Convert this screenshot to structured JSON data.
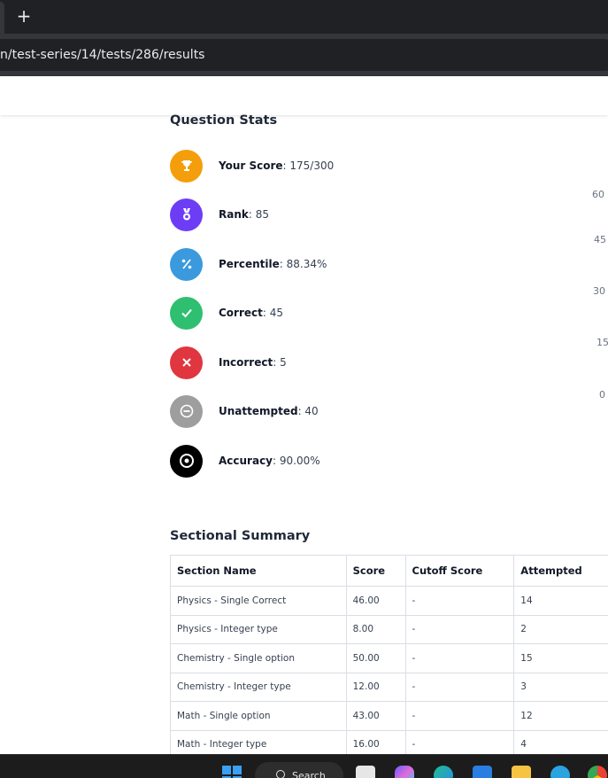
{
  "browser": {
    "new_tab_symbol": "+",
    "url": "n/test-series/14/tests/286/results"
  },
  "question_stats": {
    "title": "Question Stats",
    "items": [
      {
        "label": "Your Score",
        "value": "175/300",
        "icon": "trophy-icon",
        "color": "#f59e0b"
      },
      {
        "label": "Rank",
        "value": "85",
        "icon": "medal-icon",
        "color": "#6d3df5"
      },
      {
        "label": "Percentile",
        "value": "88.34%",
        "icon": "percent-icon",
        "color": "#3b9ade"
      },
      {
        "label": "Correct",
        "value": "45",
        "icon": "check-icon",
        "color": "#2fbf71"
      },
      {
        "label": "Incorrect",
        "value": "5",
        "icon": "x-icon",
        "color": "#e0363f"
      },
      {
        "label": "Unattempted",
        "value": "40",
        "icon": "minus-icon",
        "color": "#9e9e9e"
      },
      {
        "label": "Accuracy",
        "value": "90.00%",
        "icon": "target-icon",
        "color": "#000000"
      }
    ]
  },
  "chart_axis_ticks": [
    "60",
    "45",
    "30",
    "15",
    "0"
  ],
  "sectional_summary": {
    "title": "Sectional Summary",
    "columns": [
      "Section Name",
      "Score",
      "Cutoff Score",
      "Attempted"
    ],
    "rows": [
      [
        "Physics - Single Correct",
        "46.00",
        "-",
        "14"
      ],
      [
        "Physics - Integer type",
        "8.00",
        "-",
        "2"
      ],
      [
        "Chemistry - Single option",
        "50.00",
        "-",
        "15"
      ],
      [
        "Chemistry - Integer type",
        "12.00",
        "-",
        "3"
      ],
      [
        "Math - Single option",
        "43.00",
        "-",
        "12"
      ],
      [
        "Math - Integer type",
        "16.00",
        "-",
        "4"
      ]
    ]
  },
  "taskbar": {
    "search_label": "Search"
  }
}
